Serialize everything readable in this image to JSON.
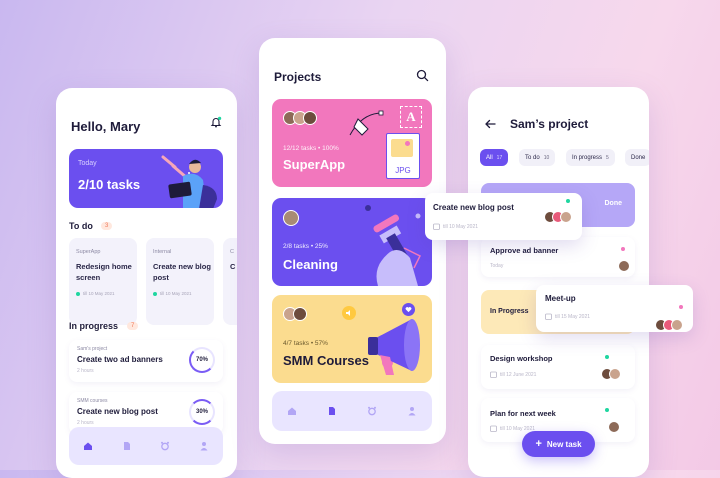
{
  "home": {
    "greeting": "Hello, Mary",
    "today_label": "Today",
    "today_value": "2/10 tasks",
    "todo_title": "To do",
    "todo_count": "3",
    "todo_cards": [
      {
        "category": "SuperApp",
        "title": "Redesign home screen",
        "date": "till 10 May 2021",
        "dot": "#1fd6a0"
      },
      {
        "category": "Internal",
        "title": "Create new blog post",
        "date": "till 10 May 2021",
        "dot": "#1fd6a0"
      },
      {
        "category": "C",
        "title": "C b",
        "date": "",
        "dot": ""
      }
    ],
    "progress_title": "In progress",
    "progress_count": "7",
    "progress_items": [
      {
        "category": "Sam's project",
        "title": "Create two ad banners",
        "time": "2 hours",
        "percent": "70%"
      },
      {
        "category": "SMM courses",
        "title": "Create new blog post",
        "time": "2 hours",
        "percent": "30%"
      }
    ]
  },
  "projects": {
    "title": "Projects",
    "items": [
      {
        "count": "12/12 tasks • 100%",
        "name": "SuperApp",
        "color": "#f277bd",
        "file_label": "JPG",
        "letter": "A"
      },
      {
        "count": "2/8 tasks • 25%",
        "name": "Cleaning",
        "color": "#6b4fef"
      },
      {
        "count": "4/7 tasks • 57%",
        "name": "SMM Courses",
        "color": "#fbdc8f"
      }
    ]
  },
  "sam": {
    "title": "Sam’s project",
    "chips": [
      {
        "label": "All",
        "count": "17"
      },
      {
        "label": "To do",
        "count": "10"
      },
      {
        "label": "In progress",
        "count": "5"
      },
      {
        "label": "Done",
        "count": ""
      }
    ],
    "done_label": "Done",
    "in_progress_label": "In Progress",
    "tasks": [
      {
        "title": "Approve ad banner",
        "date": "Today"
      },
      {
        "title": "Design workshop",
        "date": "till 12 June 2021"
      },
      {
        "title": "Plan for next week",
        "date": "till 10 May 2021"
      }
    ],
    "float_blog": {
      "title": "Create new blog post",
      "date": "till 10 May 2021"
    },
    "float_meetup": {
      "title": "Meet-up",
      "date": "till 15 May 2021"
    },
    "new_task": "New task"
  }
}
